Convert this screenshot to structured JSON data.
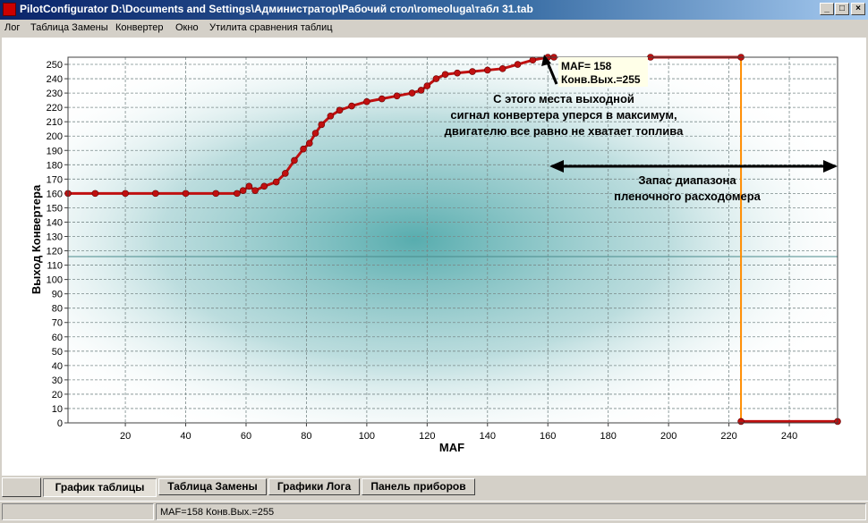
{
  "window": {
    "title": "PilotConfigurator D:\\Documents and Settings\\Администратор\\Рабочий стол\\romeoluga\\табл 31.tab",
    "minimize_symbol": "_",
    "maximize_symbol": "□",
    "close_symbol": "×",
    "icon": "app-icon"
  },
  "menu": [
    "Лог",
    "Таблица Замены",
    "Конвертер",
    "Окно",
    "Утилита сравнения таблиц"
  ],
  "chart_data": {
    "type": "line",
    "xlabel": "MAF",
    "ylabel": "Выход Конвертера",
    "xlim": [
      1,
      256
    ],
    "ylim": [
      0,
      255
    ],
    "x_ticks": [
      20,
      40,
      60,
      80,
      100,
      120,
      140,
      160,
      180,
      200,
      220,
      240
    ],
    "y_ticks": [
      0,
      10,
      20,
      30,
      40,
      50,
      60,
      70,
      80,
      90,
      100,
      110,
      120,
      130,
      140,
      150,
      160,
      170,
      180,
      190,
      200,
      210,
      220,
      230,
      240,
      250
    ],
    "grid": true,
    "series_color": "#c01010",
    "series": [
      {
        "x": [
          1,
          10,
          20,
          30,
          40,
          50,
          57,
          59,
          61,
          63,
          66,
          70,
          73,
          76,
          79,
          81,
          83,
          85,
          88,
          91,
          95,
          100,
          105,
          110,
          115,
          118,
          120,
          123,
          126,
          130,
          135,
          140,
          145,
          150,
          155,
          160,
          162
        ],
        "values": [
          160,
          160,
          160,
          160,
          160,
          160,
          160,
          162,
          165,
          162,
          165,
          168,
          174,
          183,
          191,
          195,
          202,
          208,
          214,
          218,
          221,
          224,
          226,
          228,
          230,
          232,
          235,
          240,
          243,
          244,
          245,
          246,
          247,
          250,
          253,
          255,
          255
        ]
      },
      {
        "x": [
          194,
          224
        ],
        "values": [
          255,
          255
        ]
      },
      {
        "x": [
          224,
          256
        ],
        "values": [
          1,
          1
        ]
      }
    ],
    "baseline": {
      "value": 116,
      "x": [
        1,
        256
      ],
      "color": "#4a8a8c"
    },
    "cursor_line": {
      "x": 224,
      "color": "#ff8c00"
    },
    "annotations": [
      {
        "lines": [
          "MAF= 158",
          "Конв.Вых.=255"
        ],
        "background": "#ffffe8"
      },
      {
        "lines": [
          "С этого  места  выходной",
          "сигнал  конвертера уперся в максимум,",
          "двигателю все равно не хватает топлива"
        ]
      },
      {
        "lines": [
          "Запас  диапазона",
          "пленочного расходомера"
        ]
      }
    ]
  },
  "tabs": [
    {
      "label": "График таблицы",
      "active": true
    },
    {
      "label": "Таблица Замены",
      "active": false
    },
    {
      "label": "Графики Лога",
      "active": false
    },
    {
      "label": "Панель приборов",
      "active": false
    }
  ],
  "status": {
    "text": "MAF=158   Конв.Вых.=255"
  }
}
